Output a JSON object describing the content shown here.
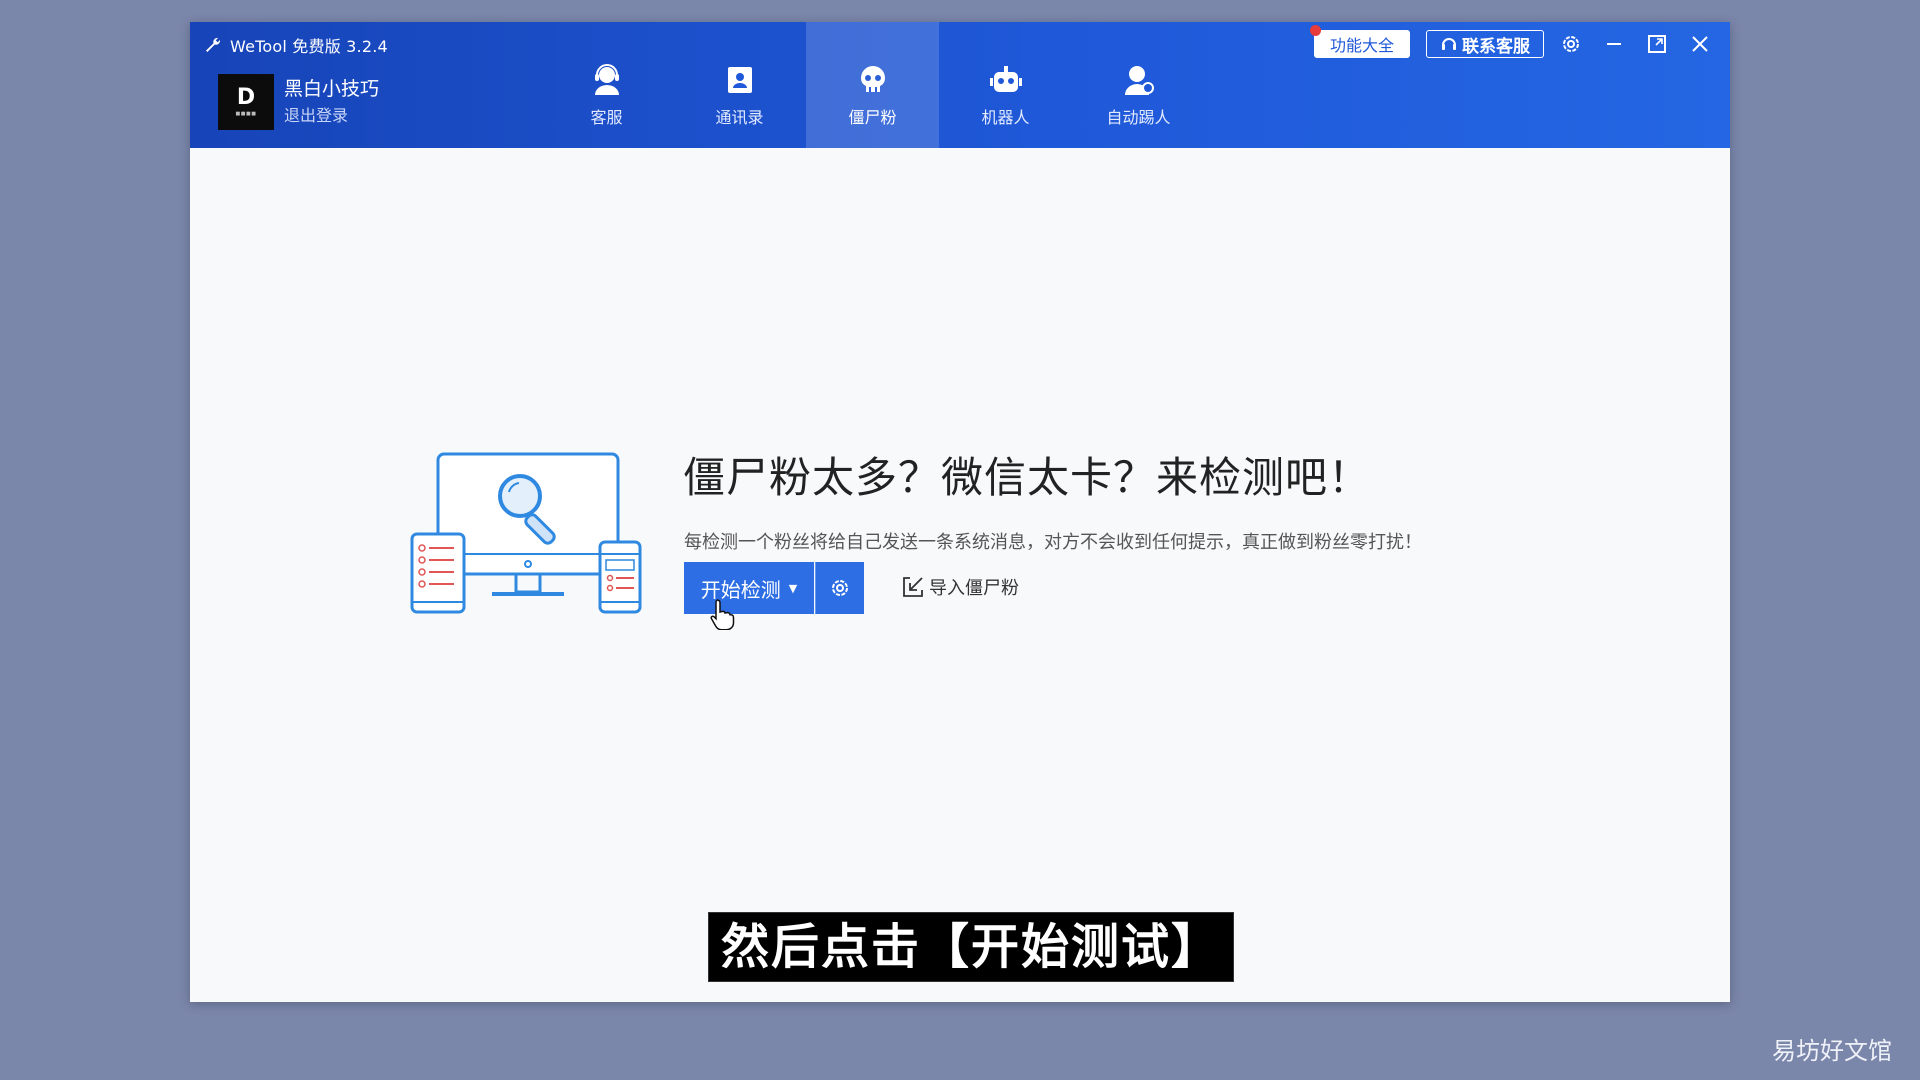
{
  "window": {
    "title": "WeTool 免费版 3.2.4"
  },
  "account": {
    "name": "黑白小技巧",
    "logout": "退出登录",
    "avatar_text": "D"
  },
  "tabs": [
    {
      "label": "客服",
      "icon": "headset-user-icon"
    },
    {
      "label": "通讯录",
      "icon": "contact-book-icon"
    },
    {
      "label": "僵尸粉",
      "icon": "skull-icon",
      "active": true
    },
    {
      "label": "机器人",
      "icon": "robot-icon"
    },
    {
      "label": "自动踢人",
      "icon": "user-remove-icon"
    }
  ],
  "top_actions": {
    "features": "功能大全",
    "service": "联系客服"
  },
  "main": {
    "headline": "僵尸粉太多？微信太卡？来检测吧！",
    "description": "每检测一个粉丝将给自己发送一条系统消息，对方不会收到任何提示，真正做到粉丝零打扰！",
    "start_button": "开始检测",
    "import_link": "导入僵尸粉"
  },
  "overlay": {
    "subtitle": "然后点击【开始测试】",
    "watermark": "易坊好文馆"
  },
  "colors": {
    "titlebar": "#1f58d8",
    "accent": "#2d6ee4",
    "background": "#7b86ab"
  }
}
